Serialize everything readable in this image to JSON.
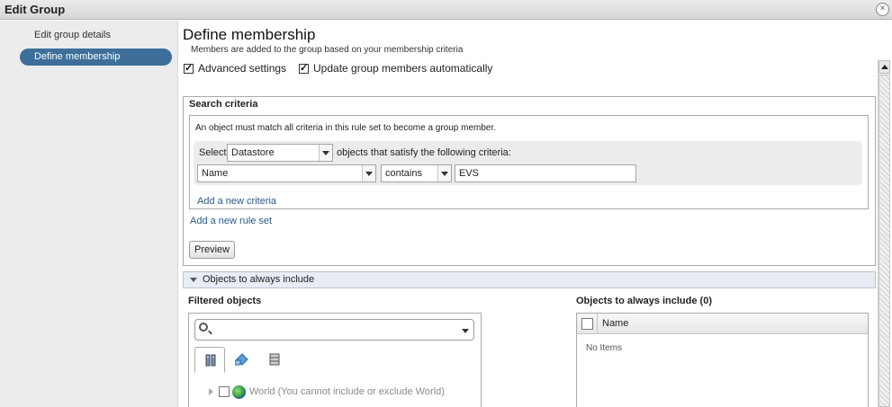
{
  "window": {
    "title": "Edit Group",
    "close_glyph": "×"
  },
  "sidebar": {
    "items": [
      {
        "label": "Edit group details",
        "active": false
      },
      {
        "label": "Define membership",
        "active": true
      }
    ]
  },
  "main": {
    "heading": "Define membership",
    "subheading": "Members are added to the group based on your membership criteria",
    "advanced_settings": {
      "label": "Advanced settings",
      "checked": true
    },
    "update_automatically": {
      "label": "Update group members automatically",
      "checked": true
    }
  },
  "search_criteria": {
    "title": "Search criteria",
    "rule_description": "An object must match all criteria in this rule set to become a group member.",
    "select_label": "Select",
    "object_type": "Datastore",
    "objects_suffix": "objects that satisfy the following criteria:",
    "criteria": {
      "field": "Name",
      "operator": "contains",
      "value": "EVS"
    },
    "add_criteria_link": "Add a new criteria",
    "add_rule_set_link": "Add a new rule set",
    "preview_button": "Preview"
  },
  "objects_section": {
    "title": "Objects to always include",
    "filtered_title": "Filtered objects",
    "search_placeholder": "",
    "tabs": [
      {
        "icon": "host-icon",
        "active": true
      },
      {
        "icon": "network-icon",
        "active": false
      },
      {
        "icon": "datastore-icon",
        "active": false
      }
    ],
    "tree_item": "World (You cannot include or exclude World)",
    "include_title": "Objects to always include (0)",
    "include_column": "Name",
    "empty_text": "No Items"
  },
  "colors": {
    "active_nav": "#3d6f9a",
    "link": "#2b5a86",
    "section_bar": "#e8edf3"
  }
}
